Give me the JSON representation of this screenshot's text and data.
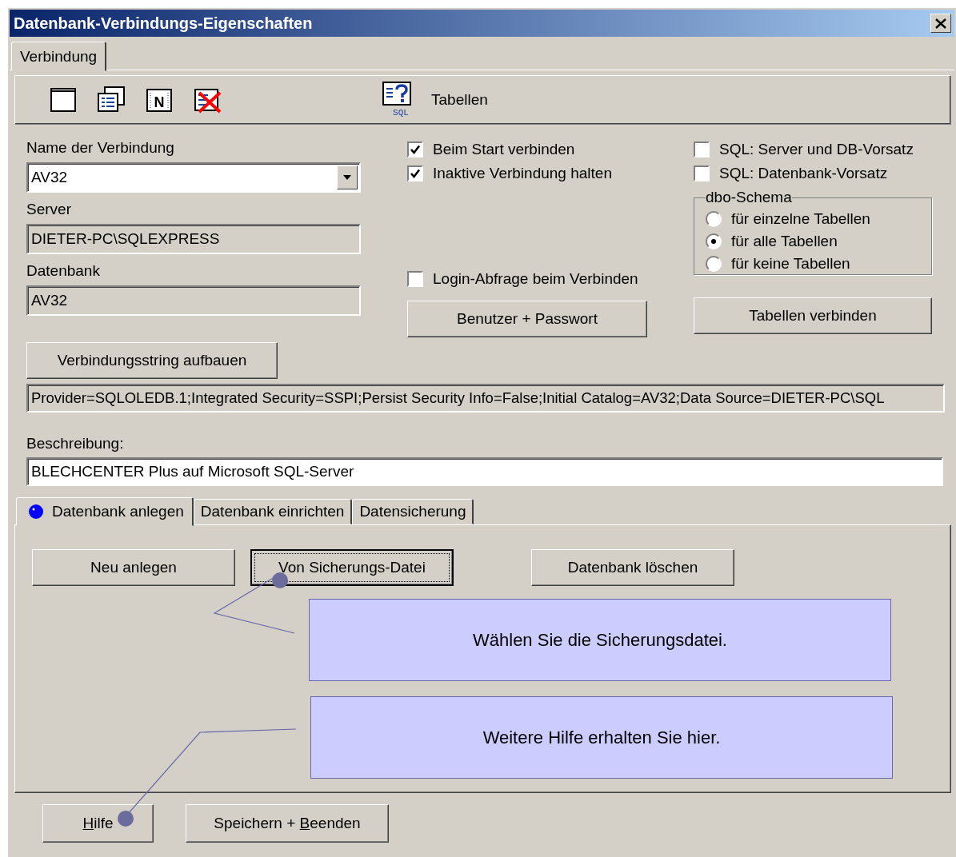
{
  "window": {
    "title": "Datenbank-Verbindungs-Eigenschaften"
  },
  "tabs": [
    {
      "label": "Verbindung",
      "selected": true
    }
  ],
  "toolbar": {
    "buttons": [
      {
        "kind": "blank"
      },
      {
        "kind": "list"
      },
      {
        "kind": "letter",
        "glyph": "N"
      },
      {
        "kind": "delete"
      }
    ],
    "tables_button": {
      "caption": "SQL",
      "label": "Tabellen"
    }
  },
  "connection": {
    "name_label": "Name der Verbindung",
    "name_value": "AV32",
    "server_label": "Server",
    "server_value": "DIETER-PC\\SQLEXPRESS",
    "database_label": "Datenbank",
    "database_value": "AV32",
    "build_button": "Verbindungsstring aufbauen"
  },
  "options": [
    {
      "label": "Beim Start verbinden",
      "checked": true
    },
    {
      "label": "Inaktive Verbindung halten",
      "checked": true
    }
  ],
  "login_option": {
    "label": "Login-Abfrage beim Verbinden",
    "checked": false
  },
  "credentials_button": "Benutzer + Passwort",
  "sql_options": [
    {
      "label": "SQL: Server und DB-Vorsatz",
      "checked": false
    },
    {
      "label": "SQL: Datenbank-Vorsatz",
      "checked": false
    }
  ],
  "dbo_schema": {
    "title": "dbo-Schema",
    "choices": [
      {
        "label": "für einzelne Tabellen",
        "selected": false
      },
      {
        "label": "für alle Tabellen",
        "selected": true
      },
      {
        "label": "für keine Tabellen",
        "selected": false
      }
    ]
  },
  "link_tables_button": "Tabellen verbinden",
  "connection_string": "Provider=SQLOLEDB.1;Integrated Security=SSPI;Persist Security Info=False;Initial Catalog=AV32;Data Source=DIETER-PC\\SQL",
  "description": {
    "label": "Beschreibung:",
    "value": "BLECHCENTER Plus auf Microsoft SQL-Server"
  },
  "sub_tabs": [
    {
      "label": "Datenbank anlegen",
      "selected": true
    },
    {
      "label": "Datenbank einrichten",
      "selected": false
    },
    {
      "label": "Datensicherung",
      "selected": false
    }
  ],
  "actions": [
    {
      "label": "Neu anlegen",
      "focused": false
    },
    {
      "label": "Von Sicherungs-Datei",
      "focused": true
    },
    {
      "label": "Datenbank löschen",
      "focused": false
    }
  ],
  "callouts": [
    {
      "text": "Wählen Sie die Sicherungsdatei."
    },
    {
      "text": "Weitere Hilfe erhalten Sie hier."
    }
  ],
  "footer_buttons": [
    {
      "key": "H",
      "after": "ilfe"
    },
    {
      "before": "Speichern + ",
      "key": "B",
      "after": "eenden"
    }
  ]
}
